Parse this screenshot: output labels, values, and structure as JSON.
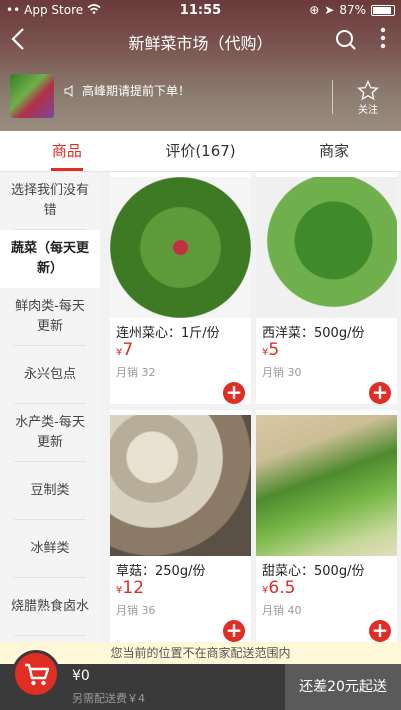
{
  "status_bar": {
    "carrier": "App Store",
    "time": "11:55",
    "battery": "87%",
    "battery_level": 0.87
  },
  "nav": {
    "back_icon": "chevron-left-icon",
    "title": "新鲜菜市场（代购）",
    "search_icon": "search-icon",
    "more_icon": "more-vertical-icon"
  },
  "shop": {
    "notice": "高峰期请提前下单！",
    "follow_label": "关注"
  },
  "tabs": [
    {
      "label": "商品"
    },
    {
      "label": "评价(167)"
    },
    {
      "label": "商家"
    }
  ],
  "categories": [
    {
      "label": "选择我们没有错"
    },
    {
      "label": "蔬菜（每天更新）"
    },
    {
      "label": "鲜肉类-每天更新"
    },
    {
      "label": "永兴包点"
    },
    {
      "label": "水产类-每天更新"
    },
    {
      "label": "豆制类"
    },
    {
      "label": "冰鲜类"
    },
    {
      "label": "烧腊熟食卤水"
    }
  ],
  "products": [
    {
      "name": "连州菜心：1斤/份",
      "currency": "¥",
      "price": "7",
      "sales": "月销 32"
    },
    {
      "name": "西洋菜：500g/份",
      "currency": "¥",
      "price": "5",
      "sales": "月销 30"
    },
    {
      "name": "草菇：250g/份",
      "currency": "¥",
      "price": "12",
      "sales": "月销 36"
    },
    {
      "name": "甜菜心：500g/份",
      "currency": "¥",
      "price": "6.5",
      "sales": "月销 40"
    }
  ],
  "bottom": {
    "delivery_notice": "您当前的位置不在商家配送范围内",
    "cart_total": "¥0",
    "delivery_fee": "另需配送费￥4",
    "checkout_label": "还差20元起送"
  },
  "colors": {
    "accent": "#e02e24"
  }
}
